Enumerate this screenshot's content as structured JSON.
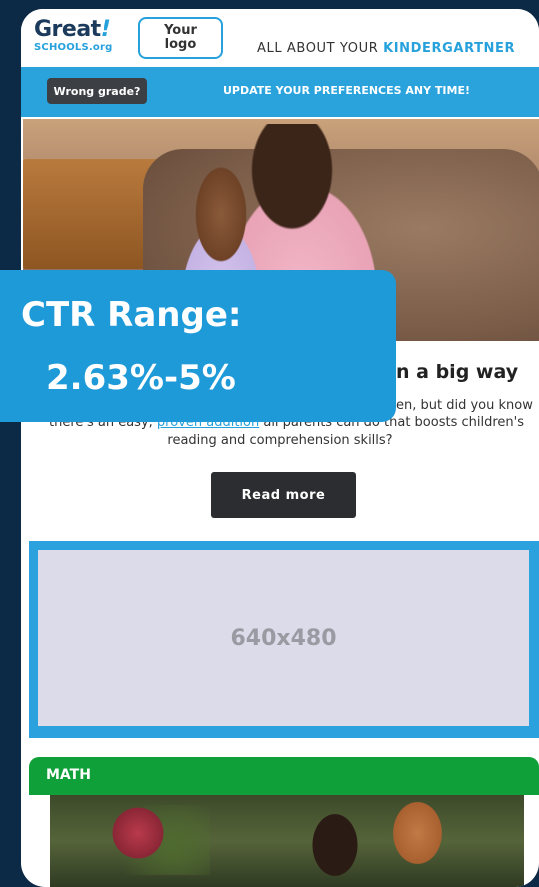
{
  "header": {
    "logo_main": "Great",
    "logo_bang": "!",
    "logo_sub": "SCHOOLS.org",
    "your_logo": "Your\nlogo",
    "tagline_prefix": "ALL ABOUT YOUR ",
    "tagline_accent": "KINDERGARTNER"
  },
  "pref_bar": {
    "wrong_grade_label": "Wrong grade?",
    "update_text": "UPDATE YOUR PREFERENCES ANY TIME!"
  },
  "article": {
    "headline_fragment": "n a big way",
    "line1_fragment": "en, but did you know",
    "line2_before": "there's an easy, ",
    "line2_link": "proven addition",
    "line2_after": " all parents can do that boosts children's",
    "line3": "reading and comprehension skills?",
    "button_label": "Read more"
  },
  "overlay": {
    "line1": "CTR Range:",
    "line2": "2.63%-5%"
  },
  "placeholder": {
    "label": "640x480"
  },
  "section": {
    "label": "MATH"
  },
  "colors": {
    "background": "#0c2a45",
    "accent": "#27a1dc",
    "overlay": "#1f9ad8",
    "math_green": "#0fa03a",
    "button_dark": "#2b2d30"
  }
}
